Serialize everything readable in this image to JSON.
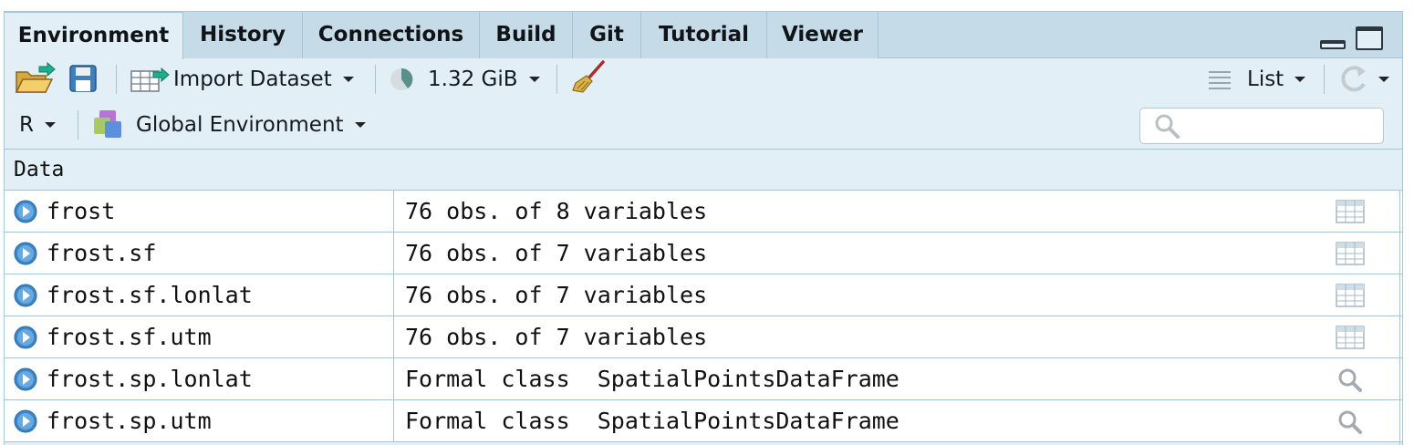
{
  "tabs": [
    {
      "label": "Environment",
      "active": true
    },
    {
      "label": "History",
      "active": false
    },
    {
      "label": "Connections",
      "active": false
    },
    {
      "label": "Build",
      "active": false
    },
    {
      "label": "Git",
      "active": false
    },
    {
      "label": "Tutorial",
      "active": false
    },
    {
      "label": "Viewer",
      "active": false
    }
  ],
  "toolbar": {
    "import_dataset": "Import Dataset",
    "memory": "1.32 GiB",
    "view_mode": "List"
  },
  "scope": {
    "language": "R",
    "environment": "Global Environment",
    "search_placeholder": ""
  },
  "section": {
    "title": "Data"
  },
  "rows": [
    {
      "name": "frost",
      "value": "76 obs. of 8 variables",
      "action": "table-view-icon"
    },
    {
      "name": "frost.sf",
      "value": "76 obs. of 7 variables",
      "action": "table-view-icon"
    },
    {
      "name": "frost.sf.lonlat",
      "value": "76 obs. of 7 variables",
      "action": "table-view-icon"
    },
    {
      "name": "frost.sf.utm",
      "value": "76 obs. of 7 variables",
      "action": "table-view-icon"
    },
    {
      "name": "frost.sp.lonlat",
      "value": "Formal class  SpatialPointsDataFrame",
      "action": "magnifier-icon"
    },
    {
      "name": "frost.sp.utm",
      "value": "Formal class  SpatialPointsDataFrame",
      "action": "magnifier-icon"
    }
  ],
  "colors": {
    "pane_bg": "#e3eff7",
    "tabbar_bg": "#c6dbe8",
    "border": "#a9c4d6",
    "expand_blue": "#3a86c8"
  }
}
